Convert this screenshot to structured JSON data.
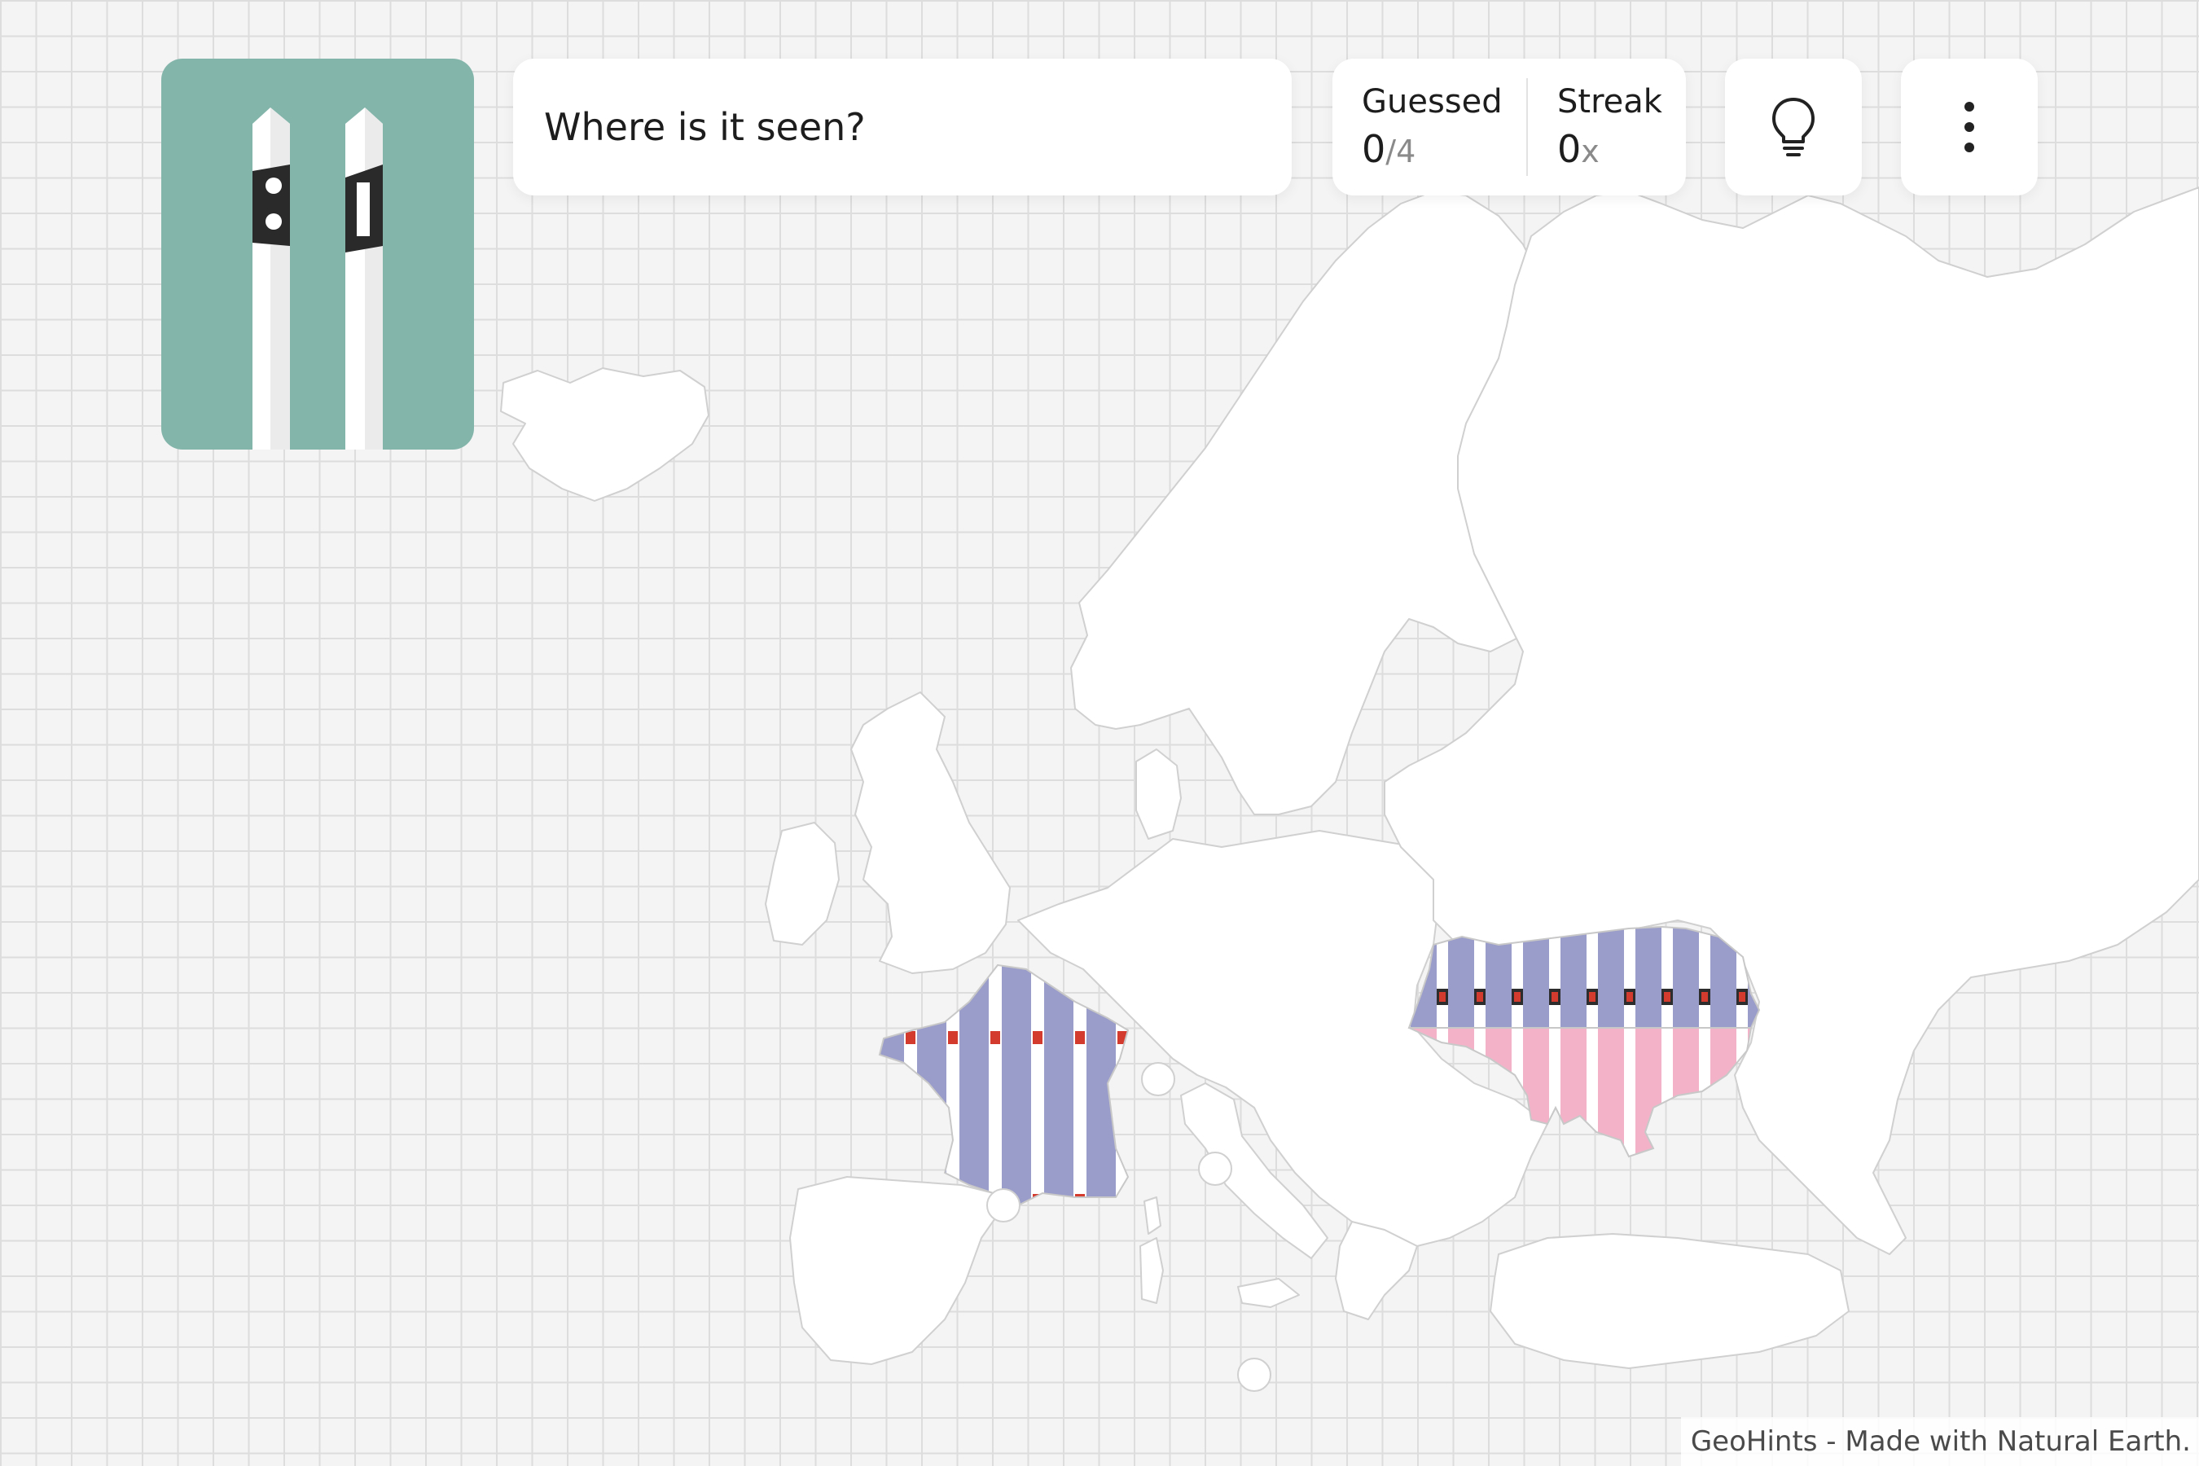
{
  "question": {
    "text": "Where is it seen?"
  },
  "stats": {
    "guessed_label": "Guessed",
    "guessed_value": "0",
    "guessed_total": "/4",
    "streak_label": "Streak",
    "streak_value": "0",
    "streak_suffix": "x"
  },
  "buttons": {
    "hint_icon": "lightbulb-icon",
    "menu_icon": "more-vertical-icon"
  },
  "hint_image": {
    "depicts": "two-white-posts-icon",
    "background_color": "#84b5ab"
  },
  "map": {
    "highlighted_countries": [
      "France",
      "Ukraine"
    ],
    "highlight_color": "#9a9cc9",
    "secondary_color": "#f4b2c8",
    "land_color": "#ffffff",
    "border_color": "#d0d0d0"
  },
  "footer": {
    "credit": "GeoHints - Made with Natural Earth."
  }
}
